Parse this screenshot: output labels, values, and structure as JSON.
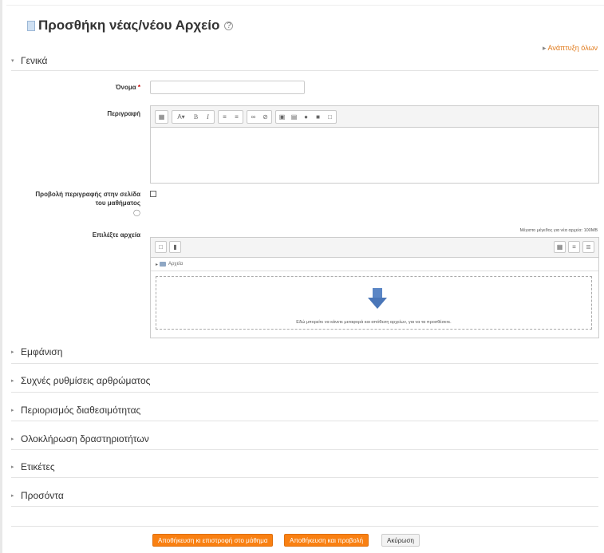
{
  "page": {
    "title": "Προσθήκη νέας/νέου Αρχείο",
    "expand_all": "Ανάπτυξη όλων"
  },
  "general": {
    "header": "Γενικά",
    "name_label": "Όνομα",
    "required_mark": "*",
    "description_label": "Περιγραφή",
    "show_description_label_line1": "Προβολή περιγραφής στην σελίδα",
    "show_description_label_line2": "του μαθήματος",
    "select_files_label": "Επιλέξτε αρχεία",
    "max_size": "Μέγιστο μέγεθος για νέα αρχεία: 100MB",
    "folder_name": "Αρχεία",
    "drop_hint": "Εδώ μπορείτε να κάνετε μεταφορά και απόθεση αρχείων, για να τα προσθέσετε."
  },
  "editor_toolbar": [
    "toggle-icon",
    "font-style-icon",
    "bold-icon",
    "italic-icon",
    "unordered-list-icon",
    "ordered-list-icon",
    "link-icon",
    "unlink-icon",
    "image-icon",
    "media-icon",
    "record-audio-icon",
    "record-video-icon",
    "manage-files-icon"
  ],
  "sections": [
    {
      "label": "Εμφάνιση"
    },
    {
      "label": "Συχνές ρυθμίσεις αρθρώματος"
    },
    {
      "label": "Περιορισμός διαθεσιμότητας"
    },
    {
      "label": "Ολοκλήρωση δραστηριοτήτων"
    },
    {
      "label": "Ετικέτες"
    },
    {
      "label": "Προσόντα"
    }
  ],
  "buttons": {
    "save_return": "Αποθήκευση κι επιστροφή στο μάθημα",
    "save_display": "Αποθήκευση και προβολή",
    "cancel": "Ακύρωση"
  },
  "colors": {
    "accent": "#f98012",
    "link": "#e07a1b"
  }
}
